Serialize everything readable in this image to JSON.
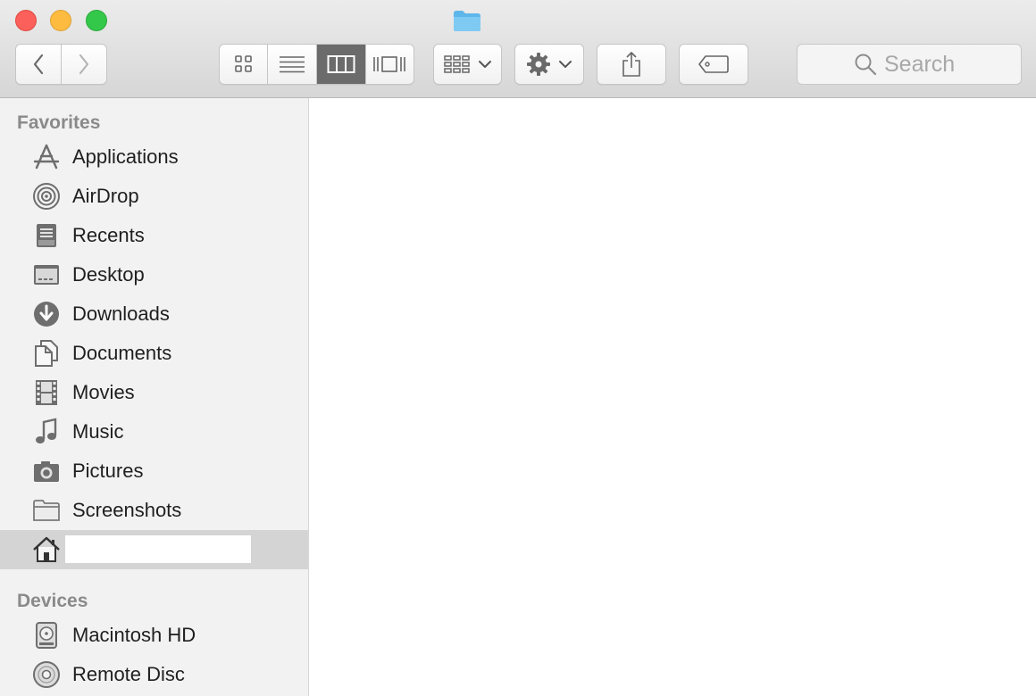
{
  "window": {
    "title_icon": "folder-icon",
    "traffic_lights": {
      "close": "#fc605b",
      "minimize": "#fdbc40",
      "zoom": "#34c84a"
    }
  },
  "toolbar": {
    "back_icon": "chevron-left-icon",
    "forward_icon": "chevron-right-icon",
    "view_modes": [
      {
        "name": "icon-view",
        "icon": "grid-icon",
        "active": false
      },
      {
        "name": "list-view",
        "icon": "list-icon",
        "active": false
      },
      {
        "name": "column-view",
        "icon": "columns-icon",
        "active": true
      },
      {
        "name": "gallery-view",
        "icon": "cover-flow-icon",
        "active": false
      }
    ],
    "arrange_icon": "arrange-grid-icon",
    "action_icon": "gear-icon",
    "share_icon": "share-icon",
    "tags_icon": "tag-icon",
    "search_placeholder": "Search"
  },
  "sidebar": {
    "favorites_title": "Favorites",
    "favorites": [
      {
        "label": "Applications",
        "icon": "applications-icon"
      },
      {
        "label": "AirDrop",
        "icon": "airdrop-icon"
      },
      {
        "label": "Recents",
        "icon": "recents-icon"
      },
      {
        "label": "Desktop",
        "icon": "desktop-icon"
      },
      {
        "label": "Downloads",
        "icon": "downloads-icon"
      },
      {
        "label": "Documents",
        "icon": "documents-icon"
      },
      {
        "label": "Movies",
        "icon": "movies-icon"
      },
      {
        "label": "Music",
        "icon": "music-icon"
      },
      {
        "label": "Pictures",
        "icon": "pictures-icon"
      },
      {
        "label": "Screenshots",
        "icon": "folder-icon"
      }
    ],
    "home_item": {
      "icon": "home-icon",
      "selected": true
    },
    "devices_title": "Devices",
    "devices": [
      {
        "label": "Macintosh HD",
        "icon": "hard-drive-icon"
      },
      {
        "label": "Remote Disc",
        "icon": "disc-icon"
      }
    ]
  },
  "colors": {
    "sidebar_bg": "#f2f2f2",
    "selected_row": "#d4d4d4",
    "active_segment": "#6b6b6b",
    "icon_gray": "#6e6e6e",
    "folder_blue": "#6cc0ee"
  }
}
